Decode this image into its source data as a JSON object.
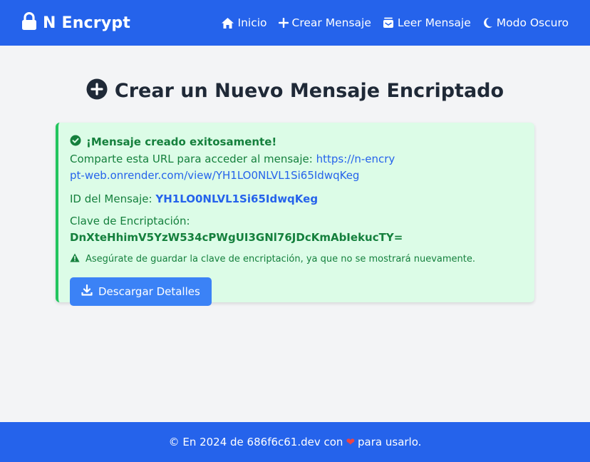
{
  "header": {
    "brand": "N Encrypt",
    "brand_icon": "lock-icon",
    "nav": [
      {
        "label": "Inicio",
        "icon": "home-icon"
      },
      {
        "label": "Crear Mensaje",
        "icon": "plus-icon"
      },
      {
        "label": "Leer Mensaje",
        "icon": "inbox-icon"
      },
      {
        "label": "Modo Oscuro",
        "icon": "moon-icon"
      }
    ]
  },
  "main": {
    "title": "Crear un Nuevo Mensaje Encriptado",
    "title_icon": "plus-circle-icon"
  },
  "result": {
    "success_title": "¡Mensaje creado exitosamente!",
    "share_label": "Comparte esta URL para acceder al mensaje:",
    "share_url": "https://n-encrypt-web.onrender.com/view/YH1LO0NLVL1Si65IdwqKeg",
    "id_label": "ID del Mensaje:",
    "id_value": "YH1LO0NLVL1Si65IdwqKeg",
    "key_label": "Clave de Encriptación:",
    "key_value": "DnXteHhimV5YzW534cPWgUI3GNl76JDcKmAbIekucTY=",
    "warning": "Asegúrate de guardar la clave de encriptación, ya que no se mostrará nuevamente.",
    "download_label": "Descargar Detalles"
  },
  "footer": {
    "text_before": "© En 2024 de 686f6c61.dev con",
    "text_after": "para usarlo.",
    "heart": "❤"
  },
  "colors": {
    "primary": "#2563eb",
    "success_bg": "#dcfce7",
    "success_text": "#15803d",
    "button": "#3b82f6"
  }
}
